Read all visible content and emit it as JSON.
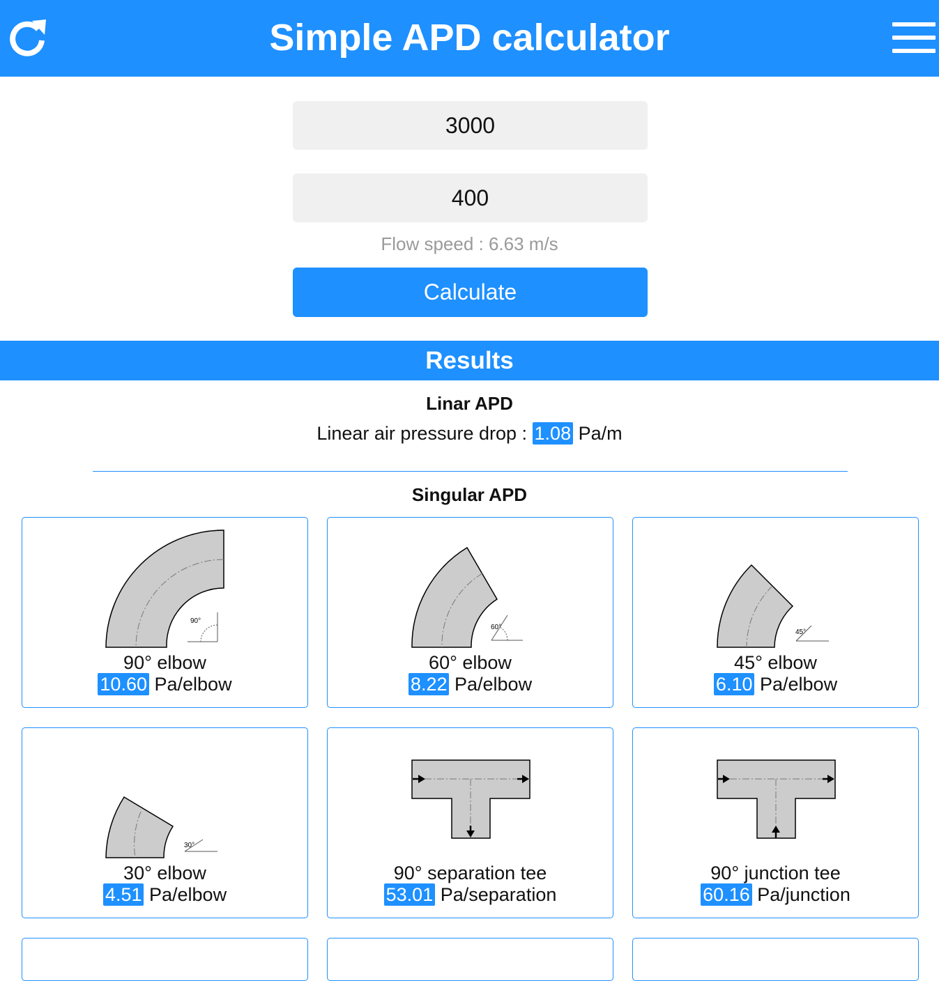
{
  "header": {
    "title": "Simple APD calculator",
    "refresh_icon": "refresh-icon",
    "menu_icon": "hamburger-menu-icon"
  },
  "form": {
    "flow_rate_value": "3000",
    "diameter_value": "400",
    "flow_speed": "Flow speed : 6.63 m/s",
    "calculate_label": "Calculate"
  },
  "results": {
    "title": "Results",
    "linear": {
      "heading": "Linar APD",
      "label": "Linear air pressure drop :",
      "value": "1.08",
      "unit": "Pa/m"
    },
    "singular_heading": "Singular APD",
    "cards": [
      {
        "name": "90° elbow",
        "value": "10.60",
        "unit": "Pa/elbow",
        "angle_label": "90°"
      },
      {
        "name": "60° elbow",
        "value": "8.22",
        "unit": "Pa/elbow",
        "angle_label": "60°"
      },
      {
        "name": "45° elbow",
        "value": "6.10",
        "unit": "Pa/elbow",
        "angle_label": "45°"
      },
      {
        "name": "30° elbow",
        "value": "4.51",
        "unit": "Pa/elbow",
        "angle_label": "30°"
      },
      {
        "name": "90° separation tee",
        "value": "53.01",
        "unit": "Pa/separation"
      },
      {
        "name": "90° junction tee",
        "value": "60.16",
        "unit": "Pa/junction"
      }
    ]
  },
  "colors": {
    "accent": "#1e90ff",
    "field_bg": "#f0f0f0",
    "hint": "#9a9a9a",
    "duct_fill": "#cccccc"
  }
}
